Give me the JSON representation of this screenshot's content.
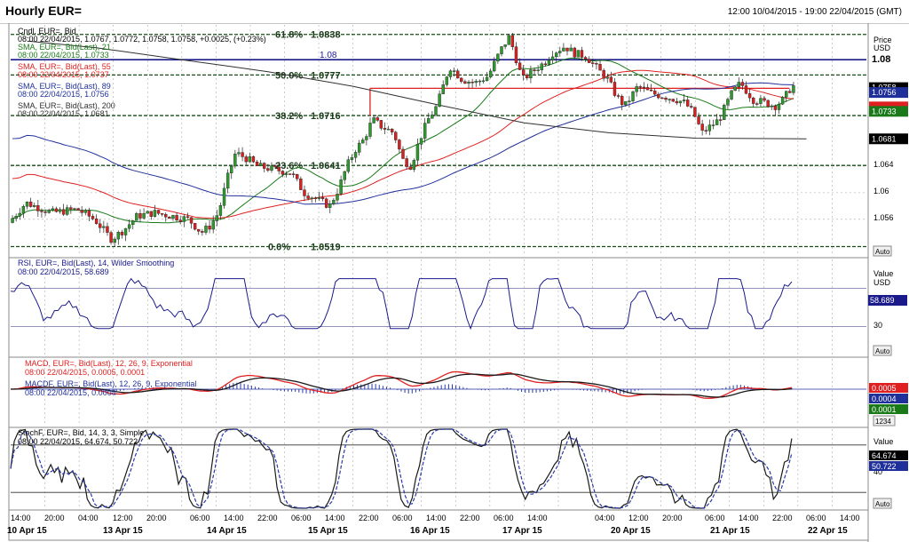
{
  "window": {
    "title": "Hourly EUR=",
    "range": "12:00 10/04/2015 - 19:00 22/04/2015 (GMT)"
  },
  "colors": {
    "bg": "#ffffff",
    "up_candle": "#2e9a2e",
    "down_candle": "#d92020",
    "sma21": "#1a7a1a",
    "sma55": "#e02020",
    "sma89": "#20309a",
    "sma200": "#303030",
    "fib_line": "#1a4d1a",
    "resistance": "#1a1a8a",
    "rsi": "#1a1a8a",
    "macd": "#e02020",
    "macd_signal": "#1a1a1a",
    "macd_hist": "#2a3aa8",
    "stoch_k": "#1a1a1a",
    "stoch_d": "#2a3aa8",
    "grid": "#a8a8a8"
  },
  "price_panel": {
    "legend": [
      {
        "text": "Cndl, EUR=, Bid",
        "color": "#000000"
      },
      {
        "text": "08:00 22/04/2015, 1.0767, 1.0772, 1.0758, 1.0758, +0.0025, (+0.23%)",
        "color": "#000000"
      },
      {
        "text": "SMA, EUR=, Bid(Last), 21",
        "color": "#1a7a1a"
      },
      {
        "text": "08:00 22/04/2015, 1.0733",
        "color": "#1a7a1a"
      },
      {
        "text": "SMA, EUR=, Bid(Last), 55",
        "color": "#e02020"
      },
      {
        "text": "08:00 22/04/2015, 1.0737",
        "color": "#e02020"
      },
      {
        "text": "SMA, EUR=, Bid(Last), 89",
        "color": "#20309a"
      },
      {
        "text": "08:00 22/04/2015, 1.0756",
        "color": "#20309a"
      },
      {
        "text": "SMA, EUR=, Bid(Last), 200",
        "color": "#303030"
      },
      {
        "text": "08:00 22/04/2015, 1.0681",
        "color": "#303030"
      }
    ],
    "axis_title": "Price",
    "axis_unit": "USD",
    "auto_label": "Auto",
    "ticks": [
      "1.064",
      "1.06",
      "1.056"
    ],
    "badges": [
      {
        "text": "1.08",
        "bg": "#ffffff",
        "fg": "#000000"
      },
      {
        "text": "1.0758",
        "bg": "#000000",
        "fg": "#ffffff"
      },
      {
        "text": "1.0756",
        "bg": "#20309a",
        "fg": "#ffffff"
      },
      {
        "text": "1.0737",
        "bg": "#e02020",
        "fg": "#e02020"
      },
      {
        "text": "1.0733",
        "bg": "#1a7a1a",
        "fg": "#ffffff"
      },
      {
        "text": "1.0681",
        "bg": "#000000",
        "fg": "#ffffff"
      }
    ],
    "fib_labels": [
      "61.8%",
      "1.0838",
      "50.0%",
      "1.0777",
      "38.2%",
      "1.0716",
      "23.6%",
      "1.0641",
      "0.0%",
      "1.0519"
    ],
    "resistance_label": "1.08"
  },
  "rsi_panel": {
    "legend": [
      "RSI, EUR=, Bid(Last), 14, Wilder Smoothing",
      "08:00 22/04/2015, 58.689"
    ],
    "axis_title": "Value",
    "axis_unit": "USD",
    "ticks": [
      "30"
    ],
    "badge": "58.689",
    "auto_label": "Auto"
  },
  "macd_panel": {
    "legend": [
      {
        "text": "MACD, EUR=, Bid(Last), 12, 26, 9, Exponential",
        "color": "#e02020"
      },
      {
        "text": "08:00 22/04/2015, 0.0005, 0.0001",
        "color": "#e02020"
      },
      {
        "text": "MACDF, EUR=, Bid(Last), 12, 26, 9, Exponential",
        "color": "#20309a"
      },
      {
        "text": "08:00 22/04/2015, 0.0004",
        "color": "#20309a"
      }
    ],
    "badges": [
      {
        "text": "0.0005",
        "bg": "#e02020",
        "fg": "#ffffff"
      },
      {
        "text": "0.0004",
        "bg": "#20309a",
        "fg": "#ffffff"
      },
      {
        "text": "0.0001",
        "bg": "#1a7a1a",
        "fg": "#ffffff"
      }
    ],
    "auto_label": "1234"
  },
  "stoch_panel": {
    "legend": [
      "StochF, EUR=, Bid, 14, 3, 3, Simple",
      "08:00 22/04/2015, 64.674, 50.722"
    ],
    "axis_title": "Value",
    "ticks": [
      "40"
    ],
    "badges": [
      {
        "text": "64.674",
        "bg": "#000000",
        "fg": "#ffffff"
      },
      {
        "text": "50.722",
        "bg": "#20309a",
        "fg": "#ffffff"
      }
    ],
    "auto_label": "Auto"
  },
  "time_axis": {
    "hour_labels": [
      "14:00",
      "20:00",
      "04:00",
      "12:00",
      "20:00",
      "06:00",
      "14:00",
      "22:00",
      "06:00",
      "14:00",
      "22:00",
      "06:00",
      "14:00",
      "22:00",
      "06:00",
      "14:00",
      "04:00",
      "12:00",
      "20:00",
      "06:00",
      "14:00",
      "22:00",
      "06:00",
      "14:00"
    ],
    "date_labels": [
      "10 Apr 15",
      "13 Apr 15",
      "14 Apr 15",
      "15 Apr 15",
      "16 Apr 15",
      "17 Apr 15",
      "20 Apr 15",
      "21 Apr 15",
      "22 Apr 15"
    ]
  },
  "chart_data": [
    {
      "type": "candlestick",
      "title": "Hourly EUR=",
      "ylabel": "Price (USD)",
      "ylim": [
        1.0505,
        1.0855
      ],
      "x_range": [
        "10/04/2015 12:00",
        "22/04/2015 19:00"
      ],
      "fibonacci_levels": [
        {
          "label": "61.8%",
          "value": 1.0838
        },
        {
          "label": "50.0%",
          "value": 1.0777
        },
        {
          "label": "38.2%",
          "value": 1.0716
        },
        {
          "label": "23.6%",
          "value": 1.0641
        },
        {
          "label": "0.0%",
          "value": 1.0519
        }
      ],
      "resistance_level": 1.08,
      "last_candle": {
        "time": "08:00 22/04/2015",
        "open": 1.0767,
        "high": 1.0772,
        "low": 1.0758,
        "close": 1.0758
      },
      "price_path": [
        [
          0,
          1.0555
        ],
        [
          0.02,
          1.0585
        ],
        [
          0.05,
          1.057
        ],
        [
          0.08,
          1.0575
        ],
        [
          0.1,
          1.056
        ],
        [
          0.12,
          1.053
        ],
        [
          0.135,
          1.0545
        ],
        [
          0.15,
          1.0565
        ],
        [
          0.17,
          1.057
        ],
        [
          0.19,
          1.0565
        ],
        [
          0.21,
          1.056
        ],
        [
          0.225,
          1.054
        ],
        [
          0.235,
          1.055
        ],
        [
          0.245,
          1.057
        ],
        [
          0.255,
          1.062
        ],
        [
          0.265,
          1.066
        ],
        [
          0.28,
          1.065
        ],
        [
          0.29,
          1.064
        ],
        [
          0.31,
          1.0635
        ],
        [
          0.33,
          1.063
        ],
        [
          0.345,
          1.06
        ],
        [
          0.36,
          1.059
        ],
        [
          0.375,
          1.058
        ],
        [
          0.385,
          1.0605
        ],
        [
          0.395,
          1.064
        ],
        [
          0.405,
          1.0665
        ],
        [
          0.415,
          1.068
        ],
        [
          0.425,
          1.071
        ],
        [
          0.435,
          1.07
        ],
        [
          0.45,
          1.069
        ],
        [
          0.46,
          1.065
        ],
        [
          0.47,
          1.064
        ],
        [
          0.48,
          1.068
        ],
        [
          0.49,
          1.071
        ],
        [
          0.5,
          1.073
        ],
        [
          0.515,
          1.079
        ],
        [
          0.53,
          1.077
        ],
        [
          0.545,
          1.0765
        ],
        [
          0.56,
          1.0775
        ],
        [
          0.575,
          1.0815
        ],
        [
          0.585,
          1.0835
        ],
        [
          0.6,
          1.077
        ],
        [
          0.61,
          1.078
        ],
        [
          0.625,
          1.0795
        ],
        [
          0.635,
          1.081
        ],
        [
          0.65,
          1.082
        ],
        [
          0.66,
          1.081
        ],
        [
          0.675,
          1.0805
        ],
        [
          0.685,
          1.079
        ],
        [
          0.7,
          1.077
        ],
        [
          0.71,
          1.0745
        ],
        [
          0.72,
          1.073
        ],
        [
          0.735,
          1.076
        ],
        [
          0.75,
          1.075
        ],
        [
          0.765,
          1.0745
        ],
        [
          0.78,
          1.074
        ],
        [
          0.79,
          1.0735
        ],
        [
          0.8,
          1.072
        ],
        [
          0.81,
          1.069
        ],
        [
          0.82,
          1.07
        ],
        [
          0.83,
          1.071
        ],
        [
          0.845,
          1.075
        ],
        [
          0.855,
          1.0765
        ],
        [
          0.87,
          1.074
        ],
        [
          0.885,
          1.0735
        ],
        [
          0.895,
          1.073
        ],
        [
          0.905,
          1.074
        ],
        [
          0.915,
          1.076
        ]
      ],
      "sma200_path": [
        [
          0.02,
          1.0828
        ],
        [
          0.1,
          1.0818
        ],
        [
          0.2,
          1.08
        ],
        [
          0.3,
          1.0782
        ],
        [
          0.4,
          1.076
        ],
        [
          0.5,
          1.0732
        ],
        [
          0.6,
          1.0705
        ],
        [
          0.7,
          1.069
        ],
        [
          0.8,
          1.0682
        ],
        [
          0.93,
          1.0681
        ]
      ]
    },
    {
      "type": "line",
      "name": "RSI 14",
      "last": 58.689,
      "ylim": [
        0,
        100
      ],
      "reference_lines": [
        70,
        30
      ]
    },
    {
      "type": "line",
      "name": "MACD 12,26,9",
      "last": {
        "macd": 0.0005,
        "signal": 0.0001,
        "hist": 0.0004
      }
    },
    {
      "type": "line",
      "name": "StochF 14,3,3",
      "last": {
        "k": 64.674,
        "d": 50.722
      }
    }
  ]
}
